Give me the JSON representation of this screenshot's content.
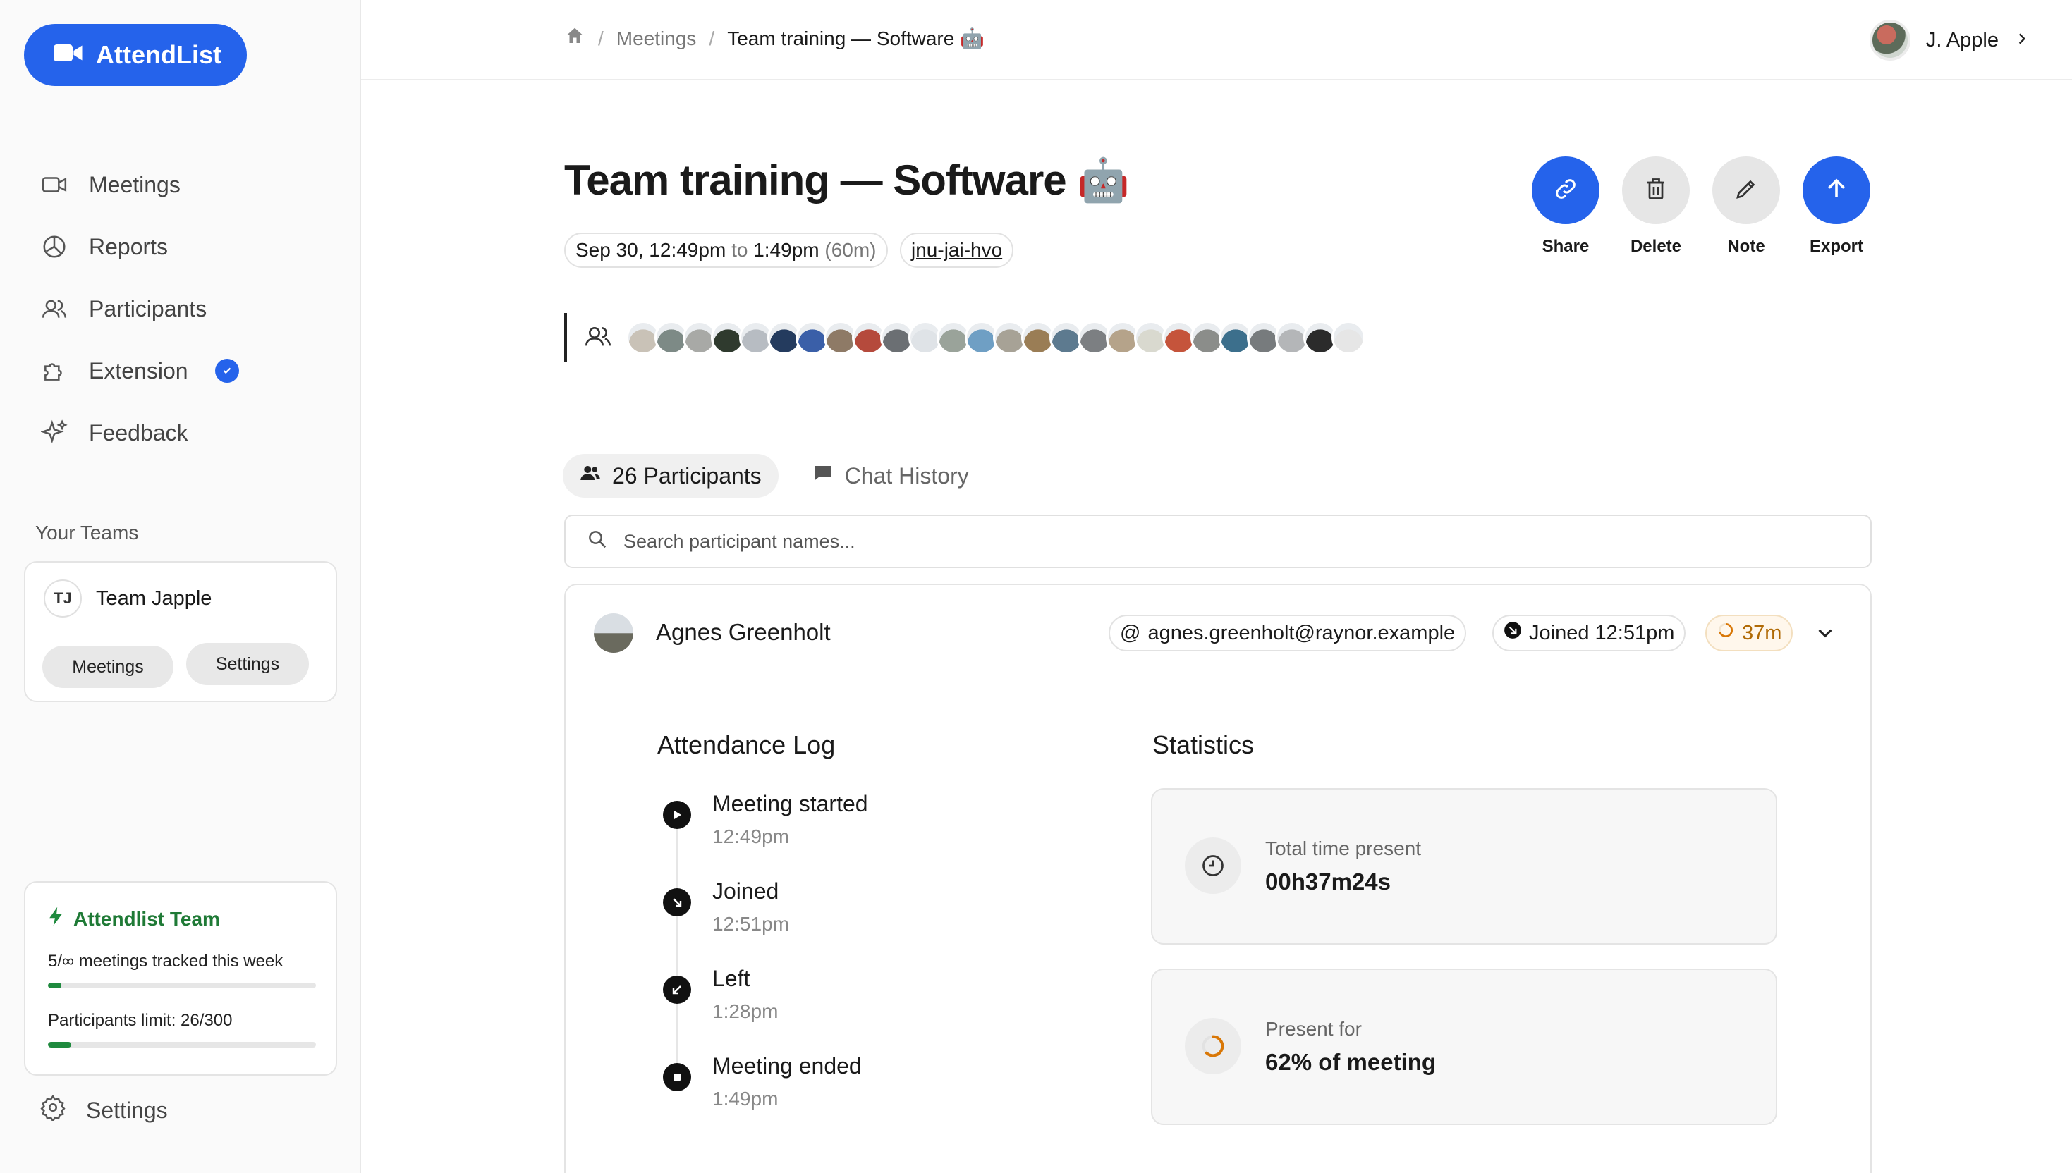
{
  "app": {
    "name": "AttendList"
  },
  "nav": [
    {
      "label": "Meetings",
      "icon": "video-icon"
    },
    {
      "label": "Reports",
      "icon": "pie-chart-icon"
    },
    {
      "label": "Participants",
      "icon": "users-icon"
    },
    {
      "label": "Extension",
      "icon": "puzzle-icon"
    },
    {
      "label": "Feedback",
      "icon": "sparkles-icon"
    }
  ],
  "teams": {
    "label": "Your Teams",
    "team": {
      "initials": "TJ",
      "name": "Team Japple",
      "meetings_label": "Meetings",
      "settings_label": "Settings"
    }
  },
  "plan": {
    "title": "Attendlist Team",
    "meetings_text": "5/∞ meetings tracked this week",
    "meetings_fraction": 0.05,
    "participants_text": "Participants limit: 26/300",
    "participants_fraction": 0.087,
    "accent": "#1f7a36"
  },
  "settings_label": "Settings",
  "breadcrumb": {
    "parent": "Meetings",
    "current": "Team training — Software 🤖"
  },
  "user": {
    "name": "J. Apple"
  },
  "meeting": {
    "title": "Team training — Software 🤖",
    "date": "Sep 30, 12:49pm",
    "to": "to",
    "end": "1:49pm",
    "duration": "(60m)",
    "code": "jnu-jai-hvo",
    "participant_avatar_colors": [
      "#c9c2b7",
      "#7d8a86",
      "#a8a9a6",
      "#2f3a2e",
      "#b7bcc2",
      "#243b5e",
      "#3a5fa8",
      "#8e7a66",
      "#b54a3c",
      "#6b6f73",
      "#dfe3e7",
      "#9aa39a",
      "#6f9fc4",
      "#a7a296",
      "#9a7d55",
      "#5d7a8f",
      "#7c7f82",
      "#b5a38a",
      "#d9d9cf",
      "#c5543b",
      "#8b8d8a",
      "#3c6f8c",
      "#777b7d",
      "#b4b6b8",
      "#2b2b2b",
      "#e6e6e6"
    ]
  },
  "actions": [
    {
      "label": "Share",
      "icon": "link-icon",
      "color": "#2563eb"
    },
    {
      "label": "Delete",
      "icon": "trash-icon",
      "color": "#e6e6e6"
    },
    {
      "label": "Note",
      "icon": "pencil-icon",
      "color": "#e6e6e6"
    },
    {
      "label": "Export",
      "icon": "arrow-up-icon",
      "color": "#2563eb"
    }
  ],
  "tabs": {
    "participants": "26 Participants",
    "chat": "Chat History"
  },
  "search": {
    "placeholder": "Search participant names..."
  },
  "participant": {
    "name": "Agnes Greenholt",
    "email": "agnes.greenholt@raynor.example",
    "joined": "Joined 12:51pm",
    "duration": "37m",
    "log_title": "Attendance Log",
    "log": [
      {
        "event": "Meeting started",
        "time": "12:49pm"
      },
      {
        "event": "Joined",
        "time": "12:51pm"
      },
      {
        "event": "Left",
        "time": "1:28pm"
      },
      {
        "event": "Meeting ended",
        "time": "1:49pm"
      }
    ],
    "stats_title": "Statistics",
    "stats": [
      {
        "label": "Total time present",
        "value": "00h37m24s"
      },
      {
        "label": "Present for",
        "value": "62% of meeting",
        "fraction": 0.62
      }
    ]
  }
}
